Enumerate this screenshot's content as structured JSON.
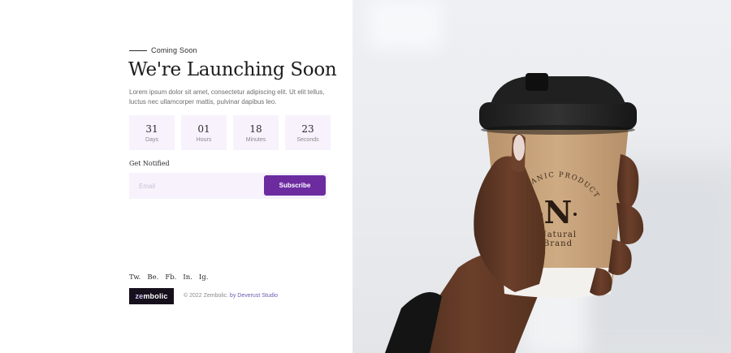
{
  "hero": {
    "eyebrow": "Coming Soon",
    "title": "We're Launching Soon",
    "description": "Lorem ipsum dolor sit amet, consectetur adipiscing elit. Ut elit tellus, luctus nec ullamcorper mattis, pulvinar dapibus leo."
  },
  "countdown": [
    {
      "value": "31",
      "label": "Days"
    },
    {
      "value": "01",
      "label": "Hours"
    },
    {
      "value": "18",
      "label": "Minutes"
    },
    {
      "value": "23",
      "label": "Seconds"
    }
  ],
  "notify": {
    "label": "Get Notified",
    "email_placeholder": "Email",
    "subscribe_label": "Subscribe"
  },
  "social": [
    "Tw.",
    "Be.",
    "Fb.",
    "In.",
    "Ig."
  ],
  "footer": {
    "logo_prefix": "ze",
    "logo_suffix": "mbolic",
    "copyright": "© 2022 Zembolic.",
    "credit": "by Deverust Studio"
  },
  "cup": {
    "arc_text": "ORGANIC PRODUCT",
    "monogram": "N",
    "brand_line1": "Natural",
    "brand_line2": "Brand"
  },
  "colors": {
    "accent": "#6c2ca0",
    "panel_tint": "#f7f2fc",
    "ink": "#2b2b2b",
    "kraft": "#c9a47c"
  }
}
